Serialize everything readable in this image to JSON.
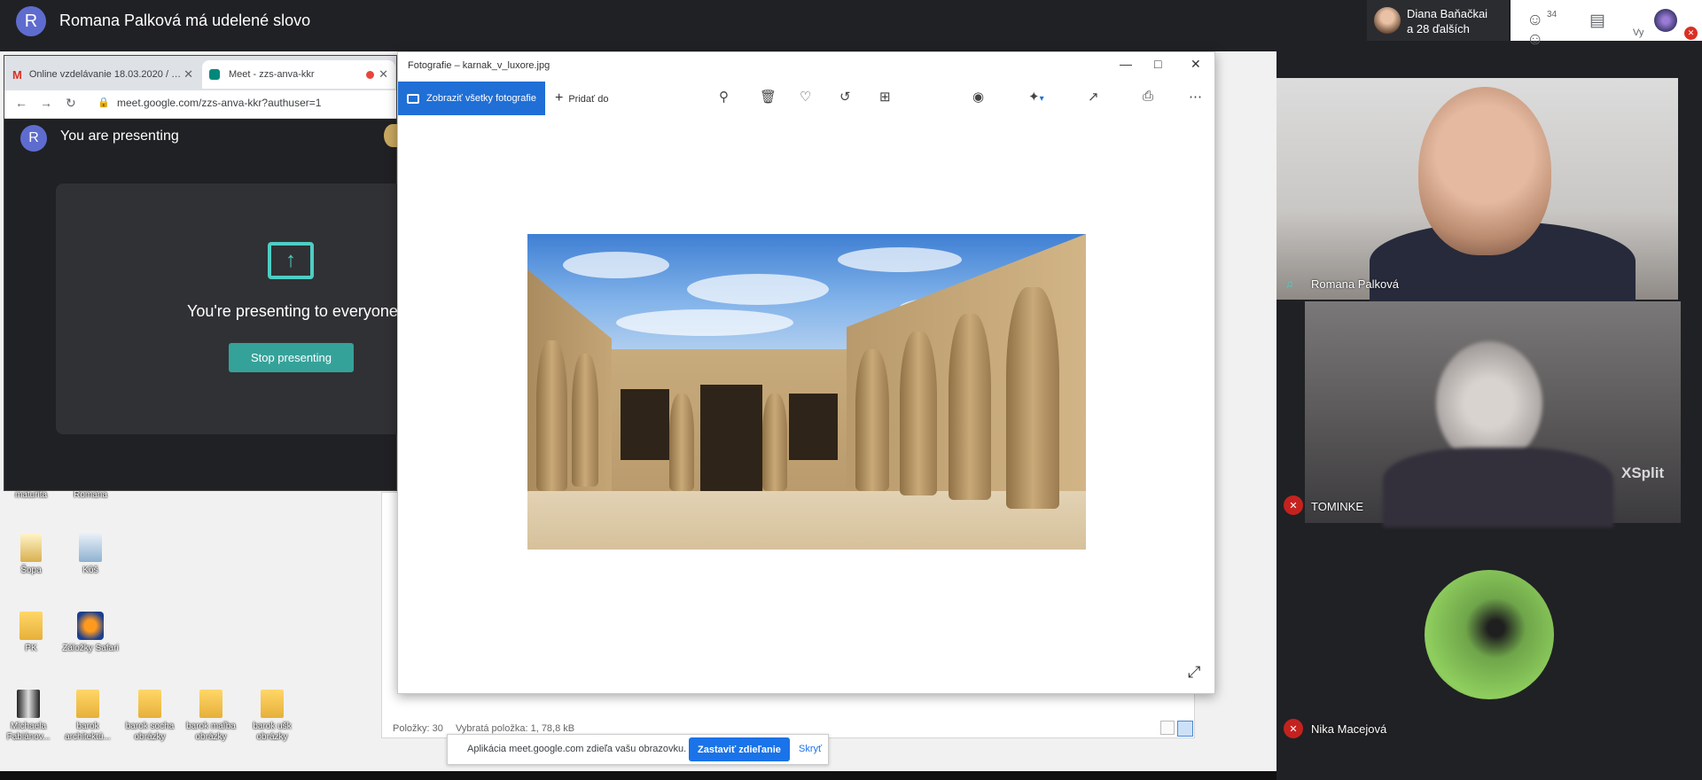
{
  "meet": {
    "speaker_avatar_letter": "R",
    "speaker_title": "Romana Palková má udelené slovo",
    "participant_chip": {
      "line1": "Diana Baňačkai",
      "line2": "a 28 ďalších"
    },
    "people_count": "34",
    "you_label": "Vy"
  },
  "browser": {
    "tabs": [
      {
        "title": "Online vzdelávanie 18.03.2020 / …",
        "icon": "gmail-icon"
      },
      {
        "title": "Meet - zzs-anva-kkr",
        "icon": "meet-icon"
      }
    ],
    "address": "meet.google.com/zzs-anva-kkr?authuser=1",
    "presenter_letter": "R",
    "presenting_label": "You are presenting",
    "presenting_everyone": "You're presenting to everyone",
    "stop_presenting": "Stop presenting"
  },
  "photos": {
    "title": "Fotografie – karnak_v_luxore.jpg",
    "see_all": "Zobraziť všetky fotografie",
    "add_to": "Pridať do"
  },
  "explorer": {
    "items": "Položky: 30",
    "selected": "Vybratá položka: 1, 78,8 kB"
  },
  "desktop_icons": [
    {
      "label": "maturita"
    },
    {
      "label": "Romana"
    },
    {
      "label": "Šopa"
    },
    {
      "label": "Kôš"
    },
    {
      "label": "PK"
    },
    {
      "label": "Záložky Safari"
    },
    {
      "label": "Michaela Fabiánov..."
    },
    {
      "label": "barok architektú..."
    },
    {
      "label": "barok socha obrázky"
    },
    {
      "label": "barok maľba obrázky"
    },
    {
      "label": "barok ušk obrázky"
    }
  ],
  "share_bar": {
    "text": "Aplikácia meet.google.com zdieľa vašu obrazovku.",
    "stop_sharing": "Zastaviť zdieľanie",
    "hide": "Skryť"
  },
  "participants": [
    {
      "name": "Romana Palková"
    },
    {
      "name": "TOMINKE"
    },
    {
      "name": "Nika Macejová"
    }
  ],
  "xsplit_watermark": "XSplit"
}
